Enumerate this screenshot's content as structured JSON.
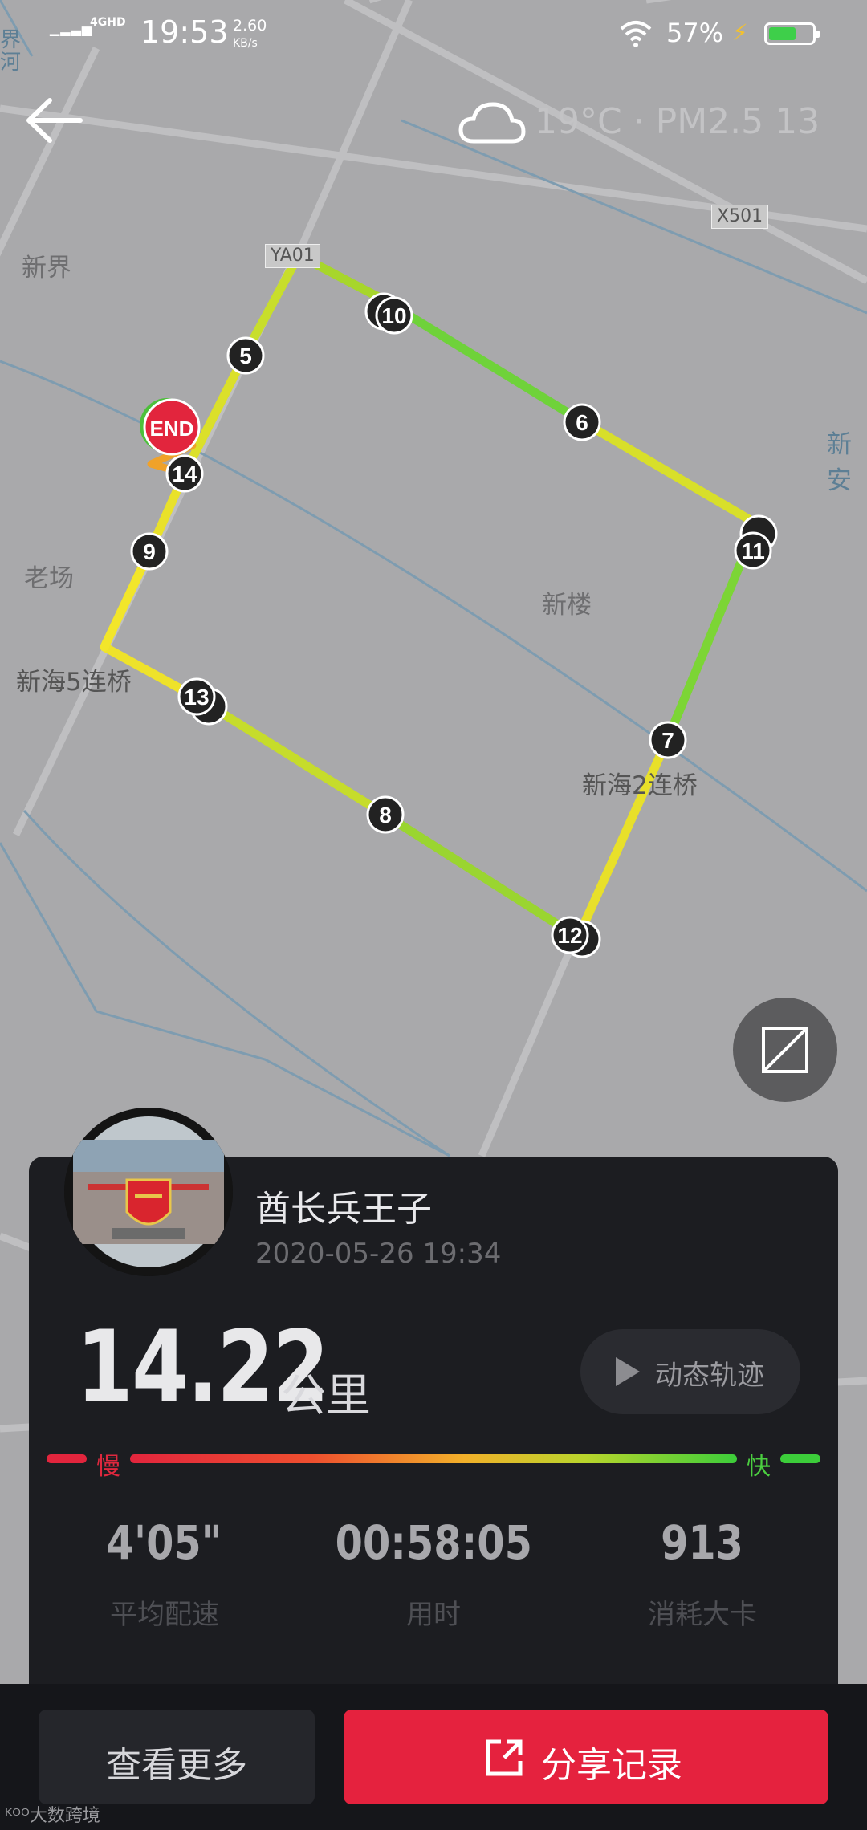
{
  "status_bar": {
    "network": "4GHD",
    "time": "19:53",
    "speed_value": "2.60",
    "speed_unit": "KB/s",
    "battery": "57%"
  },
  "header": {
    "weather": "19°C · PM2.5 13"
  },
  "map": {
    "labels": [
      "界河",
      "新界",
      "老场",
      "新海5连桥",
      "新楼",
      "新海2连桥",
      "新安"
    ],
    "road_tags": [
      "YA01",
      "X501"
    ],
    "markers": [
      "5",
      "6",
      "7",
      "8",
      "9",
      "10",
      "11",
      "12",
      "13",
      "14"
    ],
    "end_label": "END"
  },
  "record": {
    "username": "酋长兵王子",
    "datetime": "2020-05-26 19:34",
    "distance": "14.22",
    "distance_unit": "公里",
    "replay_label": "动态轨迹",
    "slow_label": "慢",
    "fast_label": "快",
    "stats": [
      {
        "value": "4'05\"",
        "label": "平均配速"
      },
      {
        "value": "00:58:05",
        "label": "用时"
      },
      {
        "value": "913",
        "label": "消耗大卡"
      }
    ]
  },
  "actions": {
    "more_label": "查看更多",
    "share_label": "分享记录"
  },
  "watermark": "大数跨境",
  "colors": {
    "accent_red": "#e5223e",
    "fast_green": "#3ccd3a",
    "card_bg": "#1c1d21"
  }
}
